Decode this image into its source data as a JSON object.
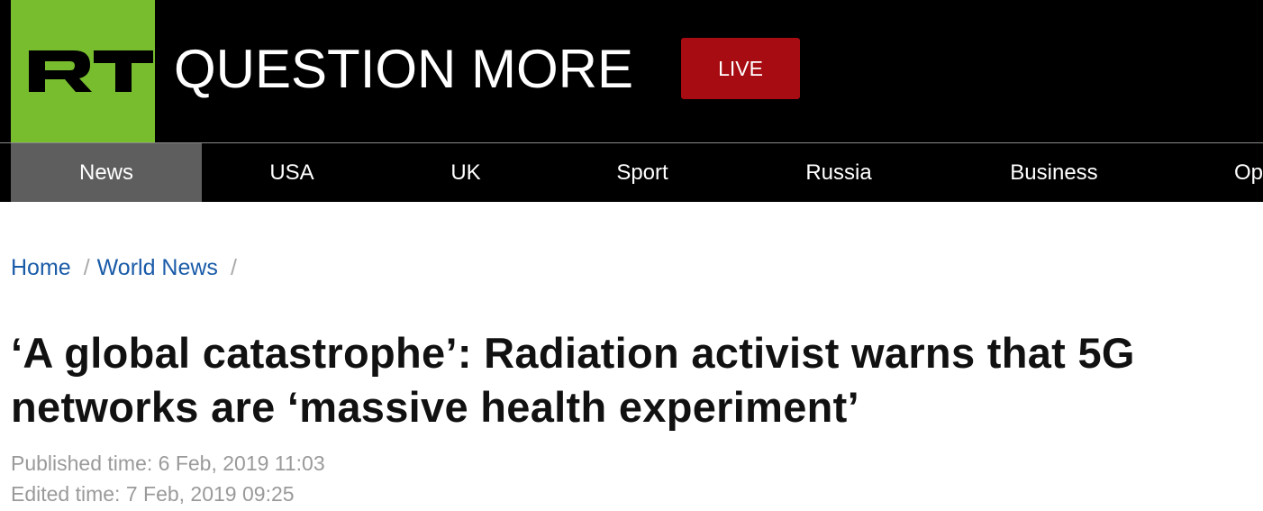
{
  "header": {
    "logo_text": "RT",
    "tagline": "QUESTION MORE",
    "live_label": "LIVE",
    "colors": {
      "logo_bg": "#77bd2e",
      "header_bg": "#000000",
      "live_bg": "#a60c12"
    }
  },
  "nav": {
    "items": [
      {
        "label": "News",
        "active": true
      },
      {
        "label": "USA"
      },
      {
        "label": "UK"
      },
      {
        "label": "Sport"
      },
      {
        "label": "Russia"
      },
      {
        "label": "Business"
      },
      {
        "label": "Op"
      }
    ]
  },
  "breadcrumb": {
    "items": [
      "Home",
      "World News"
    ],
    "separator": "/"
  },
  "article": {
    "headline": "‘A global catastrophe’: Radiation activist warns that 5G networks are ‘massive health experiment’",
    "published": "Published time: 6 Feb, 2019 11:03",
    "edited": "Edited time: 7 Feb, 2019 09:25"
  }
}
